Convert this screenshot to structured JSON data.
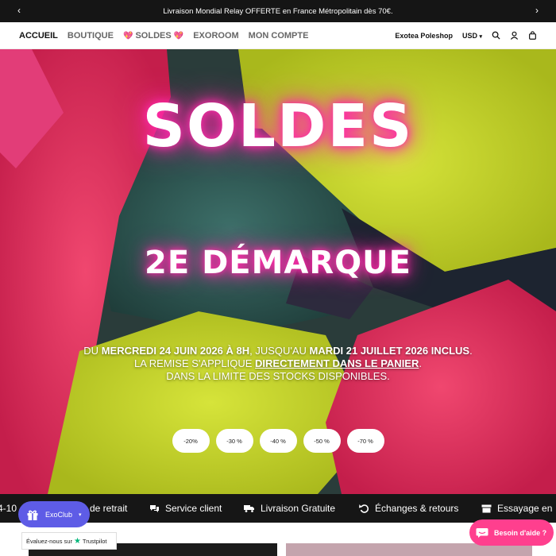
{
  "announcement": {
    "text": "Livraison Mondial Relay OFFERTE en France Métropolitain dès 70€.",
    "prev_icon": "chevron-left-icon",
    "next_icon": "chevron-right-icon"
  },
  "nav": {
    "accueil": "ACCUEIL",
    "boutique": "BOUTIQUE",
    "soldes": "SOLDES",
    "exoroom": "EXOROOM",
    "mon_compte": "MON COMPTE"
  },
  "header_right": {
    "store": "Exotea Poleshop",
    "currency": "USD",
    "icons": [
      "search-icon",
      "user-icon",
      "bag-icon"
    ]
  },
  "hero": {
    "title": "SOLDES",
    "subtitle": "2E DÉMARQUE",
    "line1_a": "DU ",
    "line1_b": "MERCREDI 24 JUIN 2026 À 8H",
    "line1_c": ", JUSQU'AU ",
    "line1_d": "MARDI 21 JUILLET 2026 INCLUS",
    "line1_e": ".",
    "line2_a": "LA REMISE S'APPLIQUE ",
    "line2_b": "DIRECTEMENT DANS LE PANIER",
    "line2_c": ".",
    "line3": "DANS LA LIMITE DES STOCKS DISPONIBLES.",
    "discounts": [
      "-20%",
      "-30 %",
      "-40 %",
      "-50 %",
      "-70 %"
    ],
    "glow_color": "#ff2aa9"
  },
  "service_bar": {
    "partial_1": "4-10",
    "partial_2": "de retrait",
    "client": "Service client",
    "livraison": "Livraison Gratuite",
    "echanges": "Échanges & retours",
    "essayage": "Essayage en"
  },
  "exoclub": {
    "label": "ExoClub",
    "icon": "gift-icon"
  },
  "trustpilot": {
    "text": "Évaluez-nous sur",
    "brand": "Trustpilot"
  },
  "chat": {
    "label": "Besoin d'aide ?",
    "icon": "chat-icon",
    "color": "#ff3f8e"
  }
}
